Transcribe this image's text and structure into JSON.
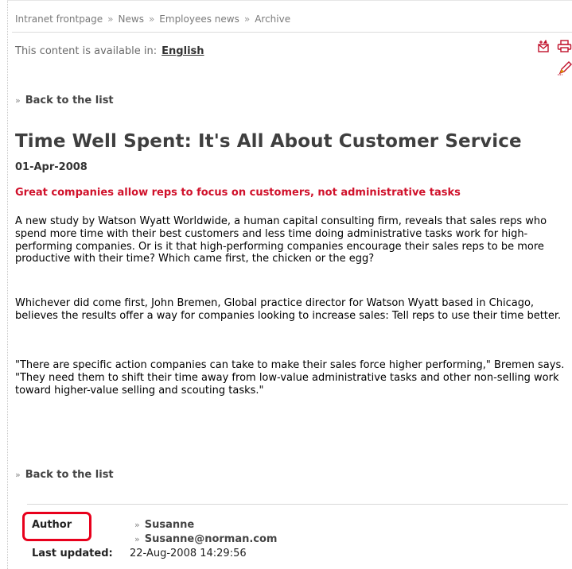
{
  "breadcrumb": {
    "items": [
      "Intranet frontpage",
      "News",
      "Employees news",
      "Archive"
    ],
    "separator": "»"
  },
  "language": {
    "label": "This content is available in:",
    "link": "English"
  },
  "toolbar": {
    "icons": [
      "send-email-icon",
      "print-icon",
      "edit-icon"
    ],
    "accent_color": "#d0112b"
  },
  "nav": {
    "arrow": "»",
    "back_label": "Back to the list"
  },
  "article": {
    "title": "Time Well Spent: It's All About Customer Service",
    "date": "01-Apr-2008",
    "subtitle": "Great companies allow reps to focus on customers, not administrative tasks",
    "paragraphs": [
      "A new study by Watson Wyatt Worldwide, a human capital consulting firm, reveals that sales reps who spend more time with their best customers and less time doing administrative tasks work for high-performing companies. Or is it that high-performing companies encourage their sales reps to be more productive with their time? Which came first, the chicken or the egg?",
      "Whichever did come first, John Bremen, Global practice director for Watson Wyatt based in Chicago, believes the results offer a way for companies looking to increase sales: Tell reps to use their time better.",
      "\"There are specific action companies can take to make their sales force higher performing,\" Bremen says. \"They need them to shift their time away from low-value administrative tasks and other non-selling work toward higher-value selling and scouting tasks.\""
    ]
  },
  "footer": {
    "author_label": "Author",
    "author_name": "Susanne",
    "author_email": "Susanne@norman.com",
    "updated_label": "Last updated:",
    "updated_value": "22-Aug-2008 14:29:56",
    "highlight_color": "#e8001c"
  }
}
